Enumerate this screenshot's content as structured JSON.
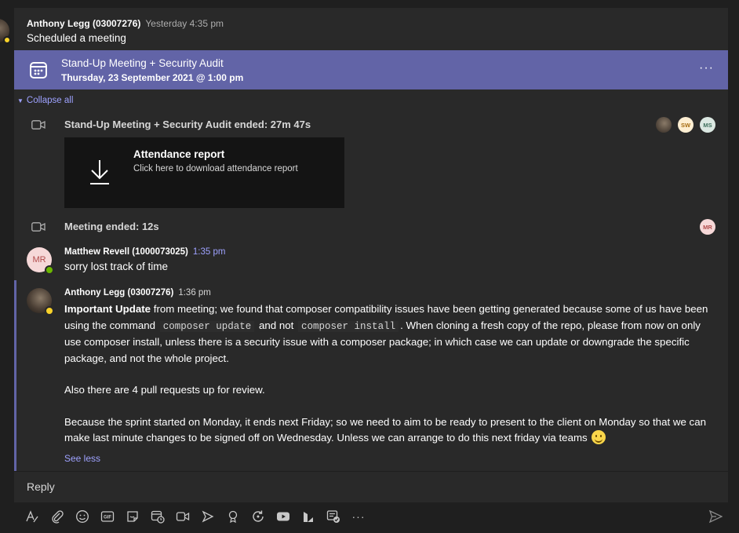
{
  "header_message": {
    "author": "Anthony Legg (03007276)",
    "time": "Yesterday 4:35 pm",
    "text": "Scheduled a meeting"
  },
  "meeting_card": {
    "title": "Stand-Up Meeting + Security Audit",
    "datetime": "Thursday, 23 September 2021 @ 1:00 pm",
    "more": "···",
    "color": "#6264a7"
  },
  "collapse_label": "Collapse all",
  "events": {
    "meeting_ended_1": {
      "text": "Stand-Up Meeting + Security Audit ended: 27m 47s",
      "participants": [
        "SW",
        "MS"
      ]
    },
    "attendance": {
      "title": "Attendance report",
      "subtitle": "Click here to download attendance report"
    },
    "meeting_ended_2": {
      "text": "Meeting ended: 12s",
      "participants": [
        "MR"
      ]
    }
  },
  "reply1": {
    "avatar_initials": "MR",
    "author": "Matthew Revell (1000073025)",
    "time": "1:35 pm",
    "text": "sorry lost track of time"
  },
  "reply2": {
    "author": "Anthony Legg (03007276)",
    "time": "1:36 pm",
    "bold_lead": "Important Update",
    "p1_a": " from meeting; we found that composer compatibility issues have been getting generated because some of us have been using the command ",
    "code1": "composer update",
    "p1_b": " and not ",
    "code2": "composer install",
    "p1_c": ". When cloning a fresh copy of the repo, please from now on only use composer install, unless there is a security issue with a composer package; in which case we can update or downgrade the specific package, and not the whole project.",
    "p2": "Also there are 4 pull requests up for review.",
    "p3": "Because the sprint started on Monday, it ends next Friday; so we need to aim to be ready to present to the client on Monday so that we can make last minute changes to be signed off on Wednesday. Unless we can arrange to do this next friday via teams ",
    "see_less": "See less"
  },
  "reply_box": {
    "placeholder": "Reply"
  },
  "toolbar": {
    "icons": [
      "format-icon",
      "attach-icon",
      "emoji-icon",
      "gif-icon",
      "sticker-icon",
      "schedule-meeting-icon",
      "meet-now-icon",
      "stream-icon",
      "praise-icon",
      "loop-icon",
      "youtube-icon",
      "approvals-icon",
      "forms-icon",
      "more-icon",
      "send-icon"
    ],
    "gif_label": "GIF",
    "more_label": "···"
  }
}
